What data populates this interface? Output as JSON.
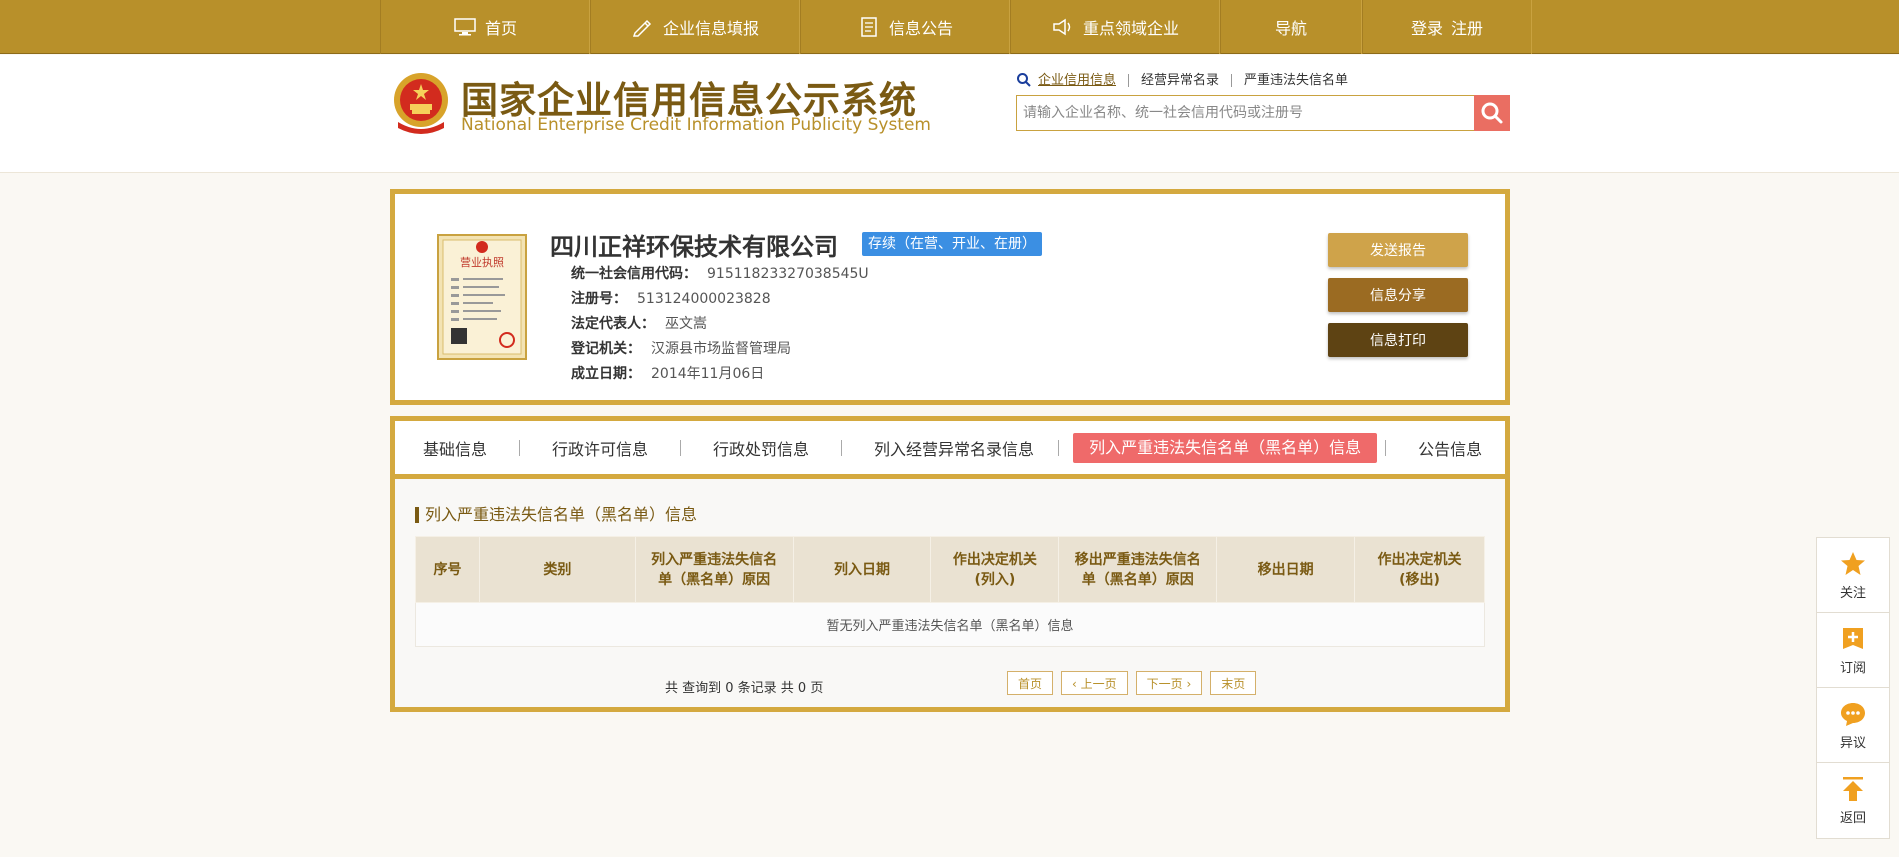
{
  "nav": {
    "home": "首页",
    "report": "企业信息填报",
    "notice": "信息公告",
    "key": "重点领域企业",
    "guide": "导航",
    "login": "登录",
    "register": "注册"
  },
  "header": {
    "title_cn": "国家企业信用信息公示系统",
    "title_en": "National Enterprise Credit Information Publicity System"
  },
  "search": {
    "tabs": [
      "企业信用信息",
      "经营异常名录",
      "严重违法失信名单"
    ],
    "placeholder": "请输入企业名称、统一社会信用代码或注册号"
  },
  "company": {
    "name": "四川正祥环保技术有限公司",
    "status": "存续（在营、开业、在册）",
    "fields": [
      {
        "k": "统一社会信用代码：",
        "v": "91511823327038545U"
      },
      {
        "k": "注册号：",
        "v": "513124000023828"
      },
      {
        "k": "法定代表人：",
        "v": "巫文嵩"
      },
      {
        "k": "登记机关：",
        "v": "汉源县市场监督管理局"
      },
      {
        "k": "成立日期：",
        "v": "2014年11月06日"
      }
    ],
    "buttons": {
      "send": "发送报告",
      "share": "信息分享",
      "print": "信息打印"
    }
  },
  "tabs": [
    "基础信息",
    "行政许可信息",
    "行政处罚信息",
    "列入经营异常名录信息",
    "列入严重违法失信名单（黑名单）信息",
    "公告信息"
  ],
  "section": {
    "title": "列入严重违法失信名单（黑名单）信息",
    "headers": [
      "序号",
      "类别",
      "列入严重违法失信名单（黑名单）原因",
      "列入日期",
      "作出决定机关(列入)",
      "移出严重违法失信名单（黑名单）原因",
      "移出日期",
      "作出决定机关(移出)"
    ],
    "empty": "暂无列入严重违法失信名单（黑名单）信息",
    "pager_info": "共 查询到 0 条记录 共 0 页",
    "pager": {
      "first": "首页",
      "prev": "‹ 上一页",
      "next": "下一页 ›",
      "last": "末页"
    }
  },
  "side": {
    "follow": "关注",
    "subscribe": "订阅",
    "objection": "异议",
    "back": "返回"
  },
  "license_text": "营业执照",
  "colors": {
    "gold": "#b8902a",
    "border": "#d4a93f",
    "badge": "#3b8fe3",
    "active_tab": "#ef6a6a",
    "side_icon": "#f0a020"
  }
}
